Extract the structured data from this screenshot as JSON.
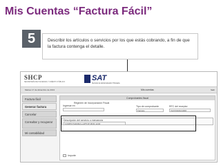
{
  "slide": {
    "title": "Mis Cuentas “Factura Fácil”",
    "step_number": "5",
    "instruction": "Describir los artículos o servicios por los que estás cobrando, a fin de que la factura contenga el detalle."
  },
  "screenshot": {
    "shcp_logo": "SHCP",
    "shcp_subtitle": "SECRETARÍA DE HACIENDA Y CRÉDITO PÚBLICO",
    "sat_logo": "SAT",
    "sat_subtitle": "Servicio de Administración Tributaria",
    "date_text": "Martes 17 de diciembre de 2013",
    "header_center": "Mis cuentas",
    "salir": "Salir",
    "menu": [
      {
        "label": "Factura fácil"
      },
      {
        "label": "Generar factura"
      },
      {
        "label": "Cancelar"
      },
      {
        "label": "Consultar y recuperar"
      },
      {
        "label": "Mi contabilidad"
      }
    ],
    "form": {
      "header": "Comprobantes fiscal",
      "regimen_label": "Régimen de Incorporación Fiscal",
      "ingresar_label": "Ingresar en",
      "tipo_label": "Tipo de comprobante",
      "tipo_value": "Factura",
      "rfc_label": "RFC del receptor",
      "rfc_value": "XAXX010101000",
      "description_label": "Descripción del servicio o mercancía",
      "description_value": "COMPUTADORA LAPTOP MOD 1234",
      "check_label": "Importe"
    }
  }
}
